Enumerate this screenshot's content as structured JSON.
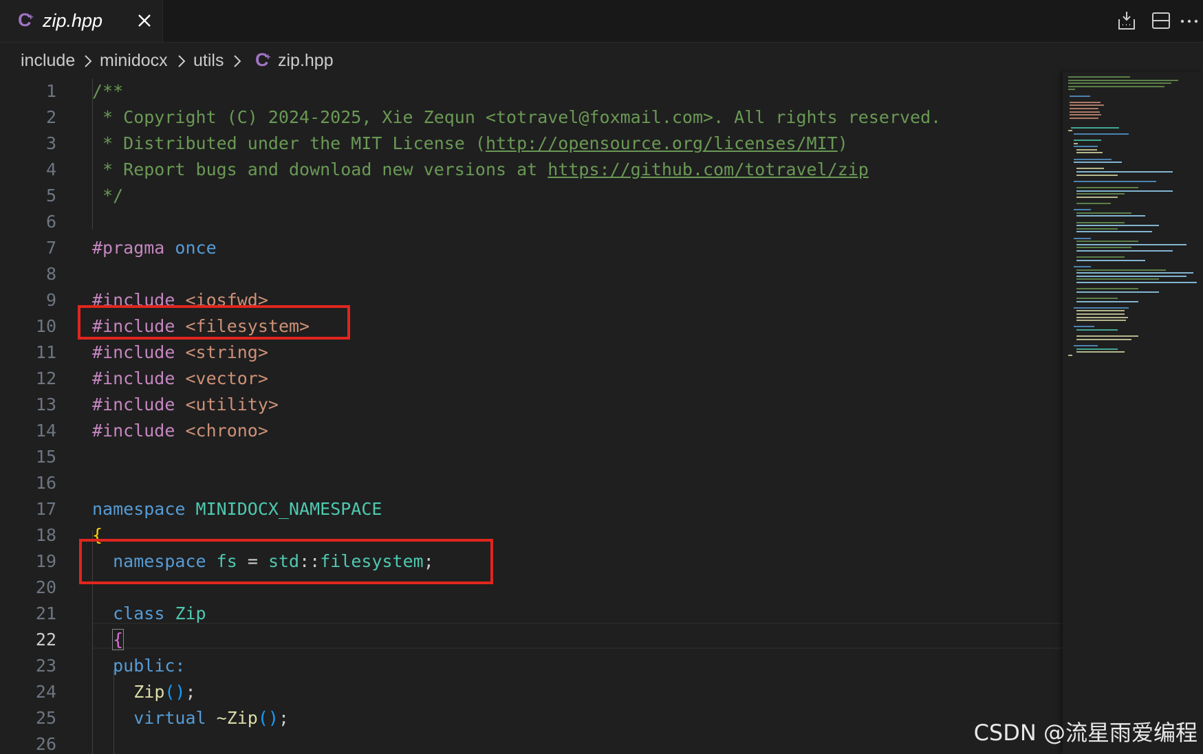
{
  "tab": {
    "filename": "zip.hpp",
    "icon": "cpp-file-icon"
  },
  "toolbar": {
    "actions": [
      "save-all-icon",
      "split-editor-icon",
      "more-actions-icon"
    ]
  },
  "breadcrumb": [
    "include",
    "minidocx",
    "utils",
    "zip.hpp"
  ],
  "editor": {
    "active_line": 22,
    "line_numbers": [
      "1",
      "2",
      "3",
      "4",
      "5",
      "6",
      "7",
      "8",
      "9",
      "10",
      "11",
      "12",
      "13",
      "14",
      "15",
      "16",
      "17",
      "18",
      "19",
      "20",
      "21",
      "22",
      "23",
      "24",
      "25",
      "26"
    ],
    "code": {
      "l1": "/**",
      "l2": " * Copyright (C) 2024-2025, Xie Zequn <totravel@foxmail.com>. All rights reserved.",
      "l3_pre": " * Distributed under the MIT License (",
      "l3_url": "http://opensource.org/licenses/MIT",
      "l3_post": ")",
      "l4_pre": " * Report bugs and download new versions at ",
      "l4_url": "https://github.com/totravel/zip",
      "l5": " */",
      "pragma_kw": "#pragma",
      "pragma_arg": "once",
      "include_kw": "#include",
      "headers": [
        "<iosfwd>",
        "<filesystem>",
        "<string>",
        "<vector>",
        "<utility>",
        "<chrono>"
      ],
      "namespace_kw": "namespace",
      "namespace_name": "MINIDOCX_NAMESPACE",
      "brace_open": "{",
      "alias_name": "fs",
      "alias_eq": "=",
      "alias_ns": "std",
      "alias_sep": "::",
      "alias_target": "filesystem",
      "semicolon": ";",
      "class_kw": "class",
      "class_name": "Zip",
      "public_kw": "public:",
      "ctor_name": "Zip",
      "parens": "()",
      "virtual_kw": "virtual",
      "dtor_name": "~Zip"
    }
  },
  "colors": {
    "highlight_box": "#e0261e",
    "comment": "#6a9955",
    "preprocessor": "#c586c0",
    "keyword": "#569cd6",
    "type": "#4ec9b0",
    "string": "#ce9178"
  },
  "watermark": "CSDN @流星雨爱编程"
}
